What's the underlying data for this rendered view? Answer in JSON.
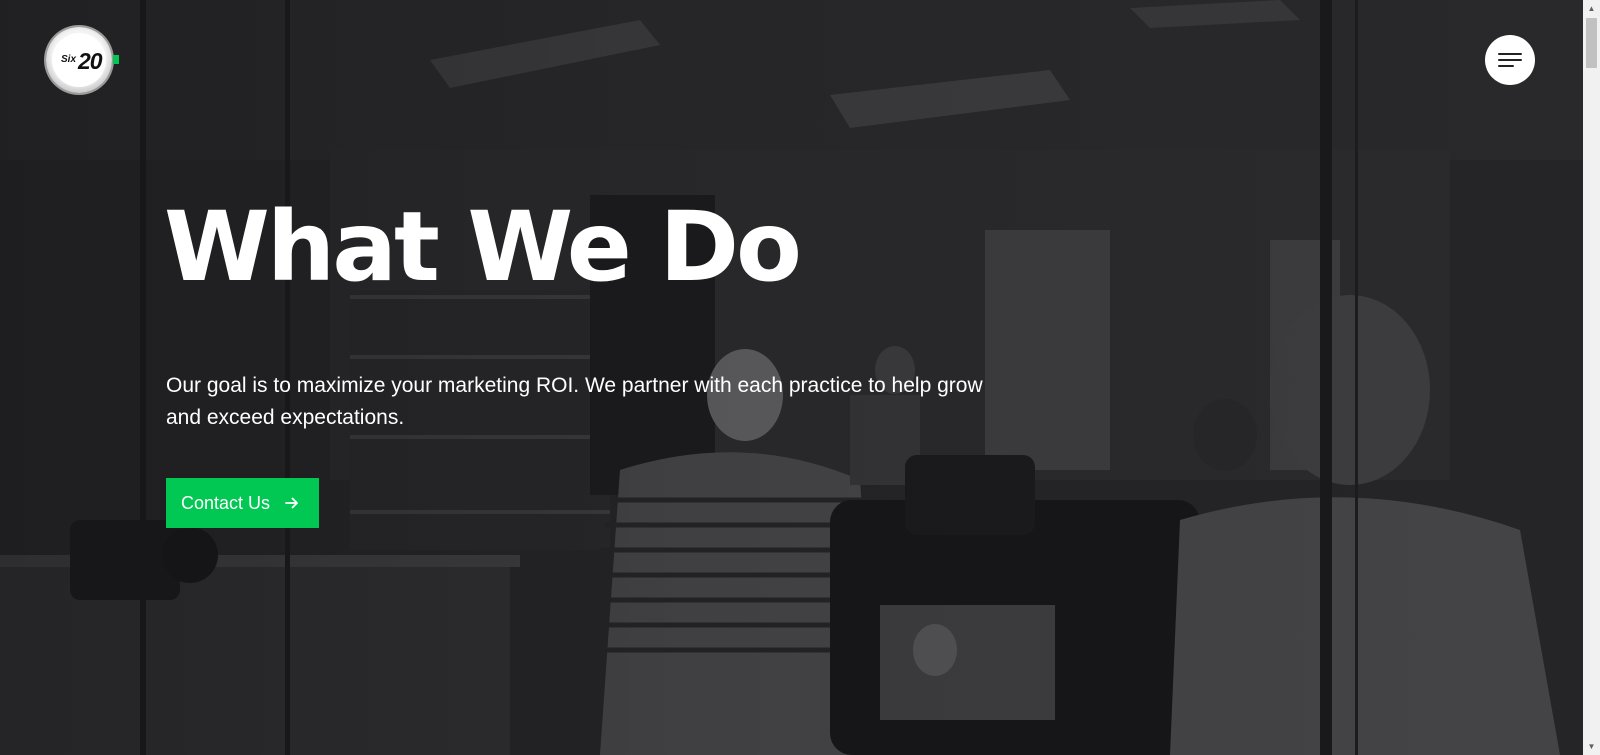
{
  "logo": {
    "text_six": "Six",
    "text_num": "20",
    "accent_color": "#00c853"
  },
  "menu": {
    "icon": "hamburger-icon"
  },
  "hero": {
    "title": "What We Do",
    "description": "Our goal is to maximize your marketing ROI. We partner with each practice to help grow and exceed expectations.",
    "cta_label": "Contact Us",
    "cta_icon": "arrow-right-icon",
    "cta_color": "#00c853"
  },
  "scrollbar": {
    "up_icon": "▲",
    "down_icon": "▼",
    "scroll_position": 0
  }
}
